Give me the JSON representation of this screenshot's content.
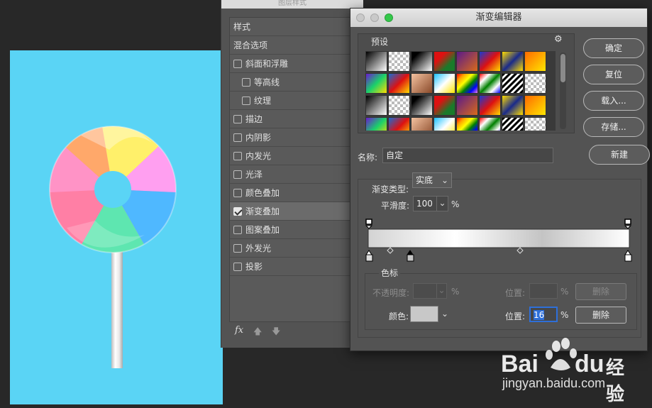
{
  "layer_style": {
    "title": "图层样式",
    "items": [
      {
        "label": "样式",
        "checkbox": false,
        "checked": false,
        "indent": 0,
        "active": false
      },
      {
        "label": "混合选项",
        "checkbox": false,
        "checked": false,
        "indent": 0,
        "active": false
      },
      {
        "label": "斜面和浮雕",
        "checkbox": true,
        "checked": false,
        "indent": 0,
        "active": false
      },
      {
        "label": "等高线",
        "checkbox": true,
        "checked": false,
        "indent": 1,
        "active": false
      },
      {
        "label": "纹理",
        "checkbox": true,
        "checked": false,
        "indent": 1,
        "active": false
      },
      {
        "label": "描边",
        "checkbox": true,
        "checked": false,
        "indent": 0,
        "active": false
      },
      {
        "label": "内阴影",
        "checkbox": true,
        "checked": false,
        "indent": 0,
        "active": false
      },
      {
        "label": "内发光",
        "checkbox": true,
        "checked": false,
        "indent": 0,
        "active": false
      },
      {
        "label": "光泽",
        "checkbox": true,
        "checked": false,
        "indent": 0,
        "active": false
      },
      {
        "label": "颜色叠加",
        "checkbox": true,
        "checked": false,
        "indent": 0,
        "active": false
      },
      {
        "label": "渐变叠加",
        "checkbox": true,
        "checked": true,
        "indent": 0,
        "active": true
      },
      {
        "label": "图案叠加",
        "checkbox": true,
        "checked": false,
        "indent": 0,
        "active": false
      },
      {
        "label": "外发光",
        "checkbox": true,
        "checked": false,
        "indent": 0,
        "active": false
      },
      {
        "label": "投影",
        "checkbox": true,
        "checked": false,
        "indent": 0,
        "active": false
      }
    ],
    "footer": {
      "fx": "fx",
      "up_icon": "arrow-up-icon",
      "down_icon": "arrow-down-icon"
    }
  },
  "gradient_editor": {
    "title": "渐变编辑器",
    "presets_label": "预设",
    "gear_icon": "gear-icon",
    "buttons": {
      "ok": "确定",
      "reset": "复位",
      "load": "载入...",
      "save": "存储...",
      "new": "新建"
    },
    "name_label": "名称:",
    "name_value": "自定",
    "type_label": "渐变类型:",
    "type_value": "实底",
    "smooth_label": "平滑度:",
    "smooth_value": "100",
    "smooth_unit": "%",
    "stops_section": "色标",
    "opacity_label": "不透明度:",
    "opacity_unit": "%",
    "position_label_1": "位置:",
    "position_unit_1": "%",
    "delete_1": "删除",
    "color_label": "颜色:",
    "position_label_2": "位置:",
    "position_value_2": "16",
    "position_unit_2": "%",
    "delete_2": "删除",
    "gradient_colors": [
      "#d3d3d3",
      "#ffffff",
      "#c4c4c4",
      "#ffffff"
    ],
    "stop_color": "#c8c8c8"
  },
  "watermark": {
    "brand": "Bai",
    "brand2": "du",
    "site_cn": "经验",
    "url": "jingyan.baidu.com"
  },
  "colors": {
    "canvas_bg": "#5ad4f5",
    "panel_bg": "#535353",
    "accent": "#2e6fd9"
  }
}
